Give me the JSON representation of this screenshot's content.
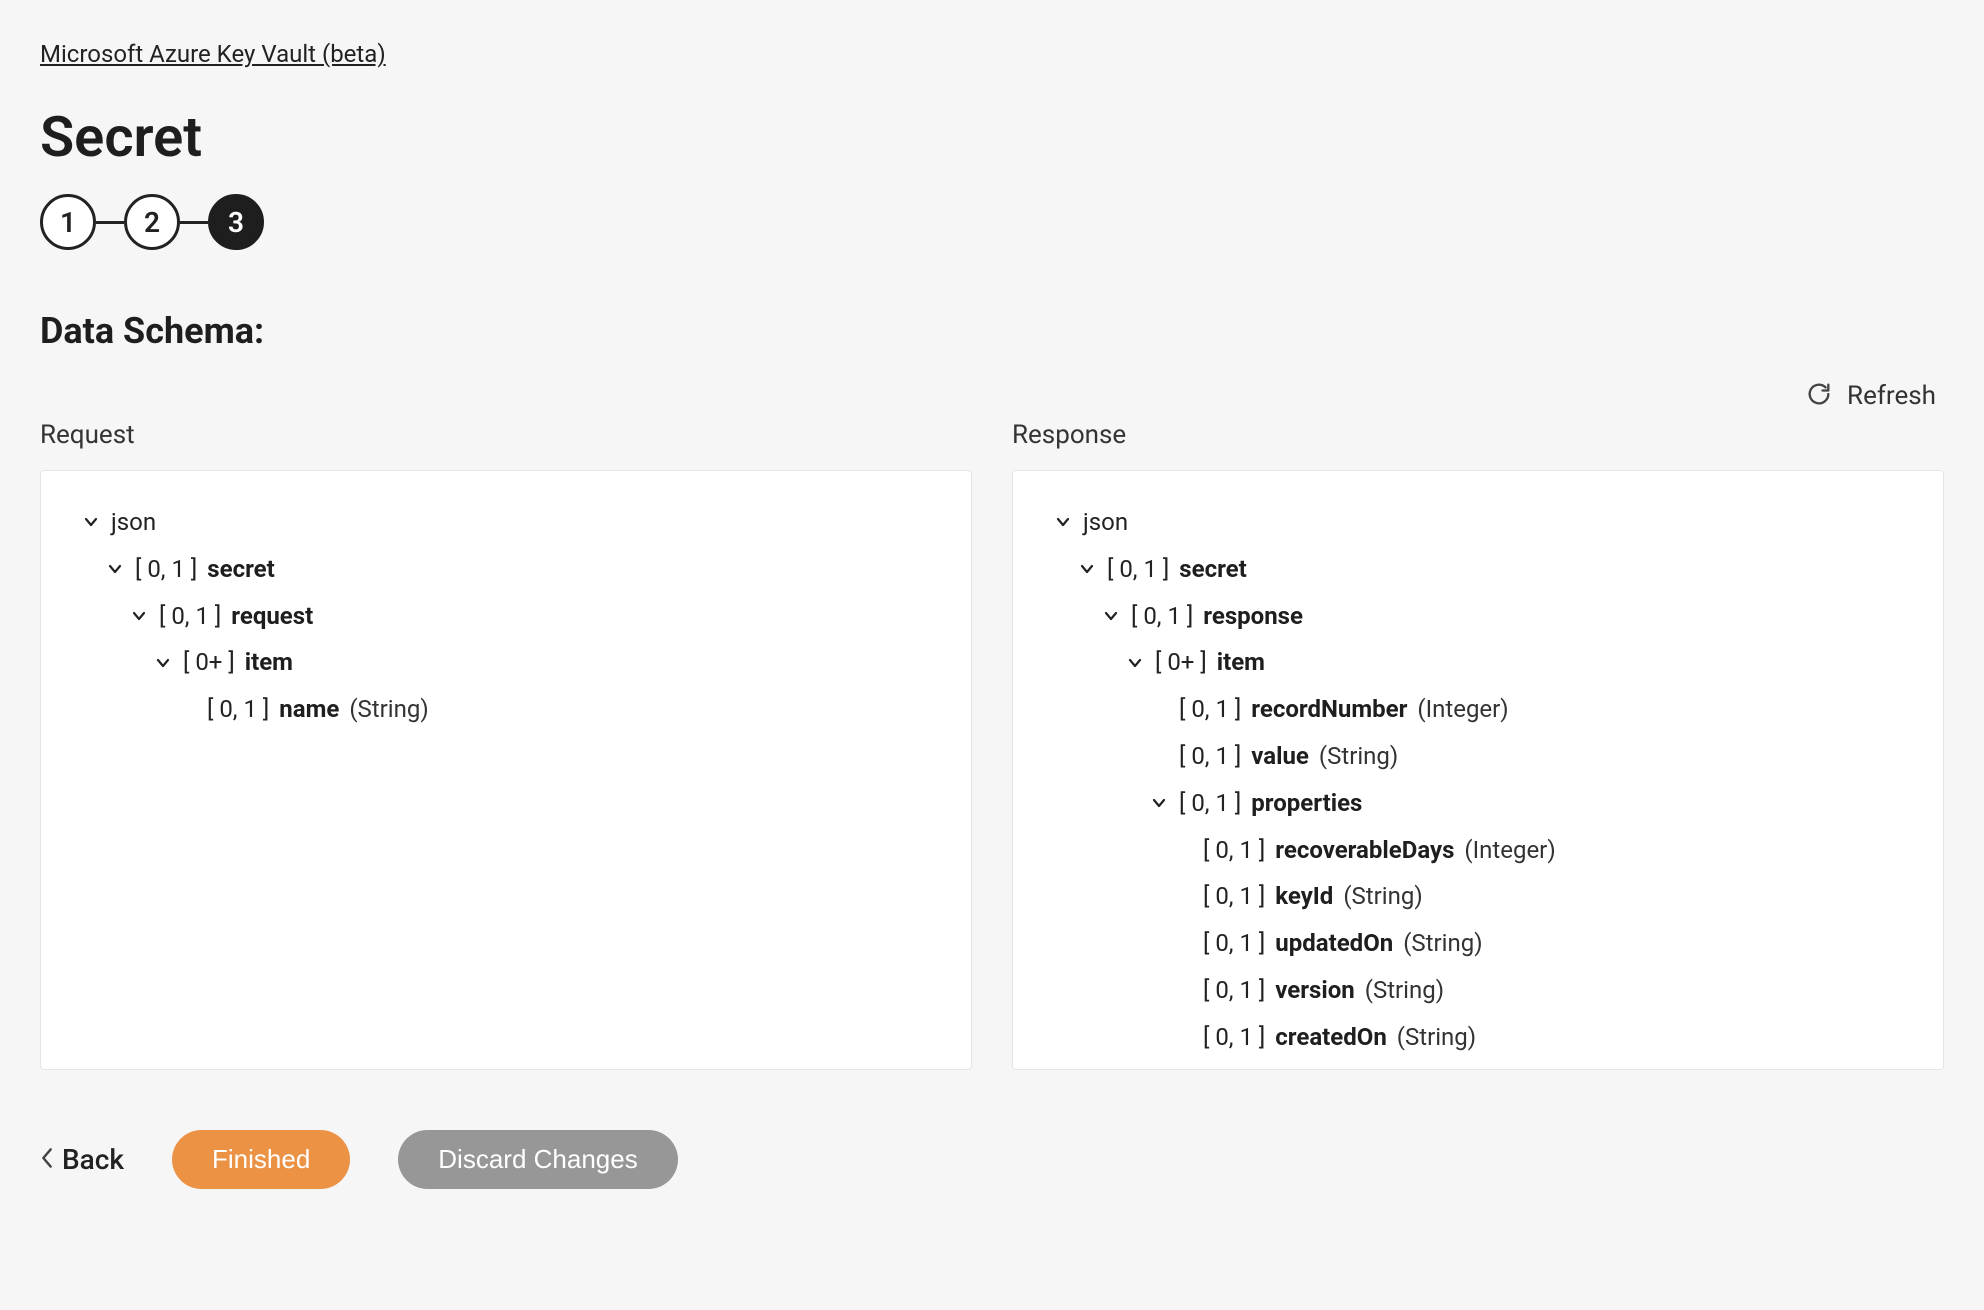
{
  "breadcrumb": "Microsoft Azure Key Vault (beta)",
  "page_title": "Secret",
  "stepper": {
    "steps": [
      "1",
      "2",
      "3"
    ],
    "active_index": 2
  },
  "section_title": "Data Schema:",
  "refresh_label": "Refresh",
  "request_label": "Request",
  "response_label": "Response",
  "request_tree": [
    {
      "indent": 0,
      "chevron": true,
      "plain": "json"
    },
    {
      "indent": 1,
      "chevron": true,
      "card": "[ 0, 1 ]",
      "name": "secret"
    },
    {
      "indent": 2,
      "chevron": true,
      "card": "[ 0, 1 ]",
      "name": "request"
    },
    {
      "indent": 3,
      "chevron": true,
      "card": "[ 0+ ]",
      "name": "item"
    },
    {
      "indent": 4,
      "chevron": false,
      "card": "[ 0, 1 ]",
      "name": "name",
      "type": "(String)"
    }
  ],
  "response_tree": [
    {
      "indent": 0,
      "chevron": true,
      "plain": "json"
    },
    {
      "indent": 1,
      "chevron": true,
      "card": "[ 0, 1 ]",
      "name": "secret"
    },
    {
      "indent": 2,
      "chevron": true,
      "card": "[ 0, 1 ]",
      "name": "response"
    },
    {
      "indent": 3,
      "chevron": true,
      "card": "[ 0+ ]",
      "name": "item"
    },
    {
      "indent": 4,
      "chevron": false,
      "card": "[ 0, 1 ]",
      "name": "recordNumber",
      "type": "(Integer)"
    },
    {
      "indent": 4,
      "chevron": false,
      "card": "[ 0, 1 ]",
      "name": "value",
      "type": "(String)"
    },
    {
      "indent": 4,
      "chevron": true,
      "card": "[ 0, 1 ]",
      "name": "properties"
    },
    {
      "indent": 5,
      "chevron": false,
      "card": "[ 0, 1 ]",
      "name": "recoverableDays",
      "type": "(Integer)"
    },
    {
      "indent": 5,
      "chevron": false,
      "card": "[ 0, 1 ]",
      "name": "keyId",
      "type": "(String)"
    },
    {
      "indent": 5,
      "chevron": false,
      "card": "[ 0, 1 ]",
      "name": "updatedOn",
      "type": "(String)"
    },
    {
      "indent": 5,
      "chevron": false,
      "card": "[ 0, 1 ]",
      "name": "version",
      "type": "(String)"
    },
    {
      "indent": 5,
      "chevron": false,
      "card": "[ 0, 1 ]",
      "name": "createdOn",
      "type": "(String)"
    }
  ],
  "footer": {
    "back": "Back",
    "finished": "Finished",
    "discard": "Discard Changes"
  }
}
